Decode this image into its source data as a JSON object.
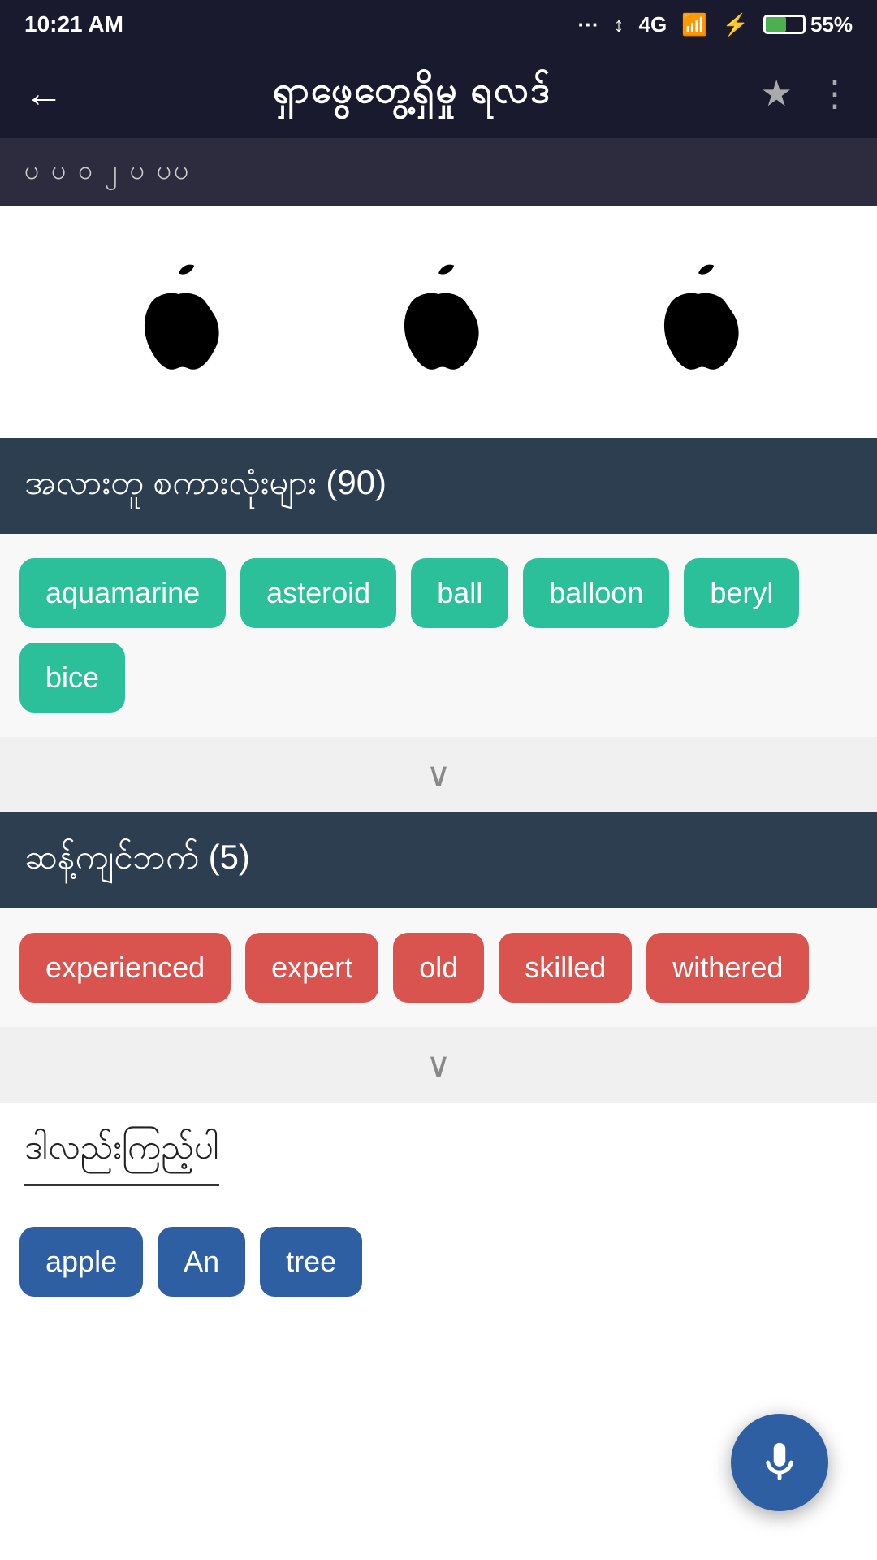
{
  "statusBar": {
    "time": "10:21 AM",
    "signal": "...",
    "network": "4G",
    "battery": "55%"
  },
  "appBar": {
    "back": "←",
    "title": "ရှာဖွေတွေ့ရှိမှု ရလဒ်",
    "starLabel": "★",
    "moreLabel": "⋮"
  },
  "tabBar": {
    "text": "ပ  ပ    ဝ  ၂  ပ           ပပ"
  },
  "colorsSection": {
    "header": "အလားတူ စကားလုံးများ (90)",
    "tags": [
      "aquamarine",
      "asteroid",
      "ball",
      "balloon",
      "beryl",
      "bice"
    ]
  },
  "synonymsSection": {
    "header": "ဆန့်ကျင်ဘက် (5)",
    "tags": [
      "experienced",
      "expert",
      "old",
      "skilled",
      "withered"
    ]
  },
  "bottomSection": {
    "title": "ဒါလည်းကြည့်ပါ",
    "tags": [
      "apple",
      "An",
      "tree"
    ]
  },
  "chevron": "∨",
  "mic": "mic"
}
